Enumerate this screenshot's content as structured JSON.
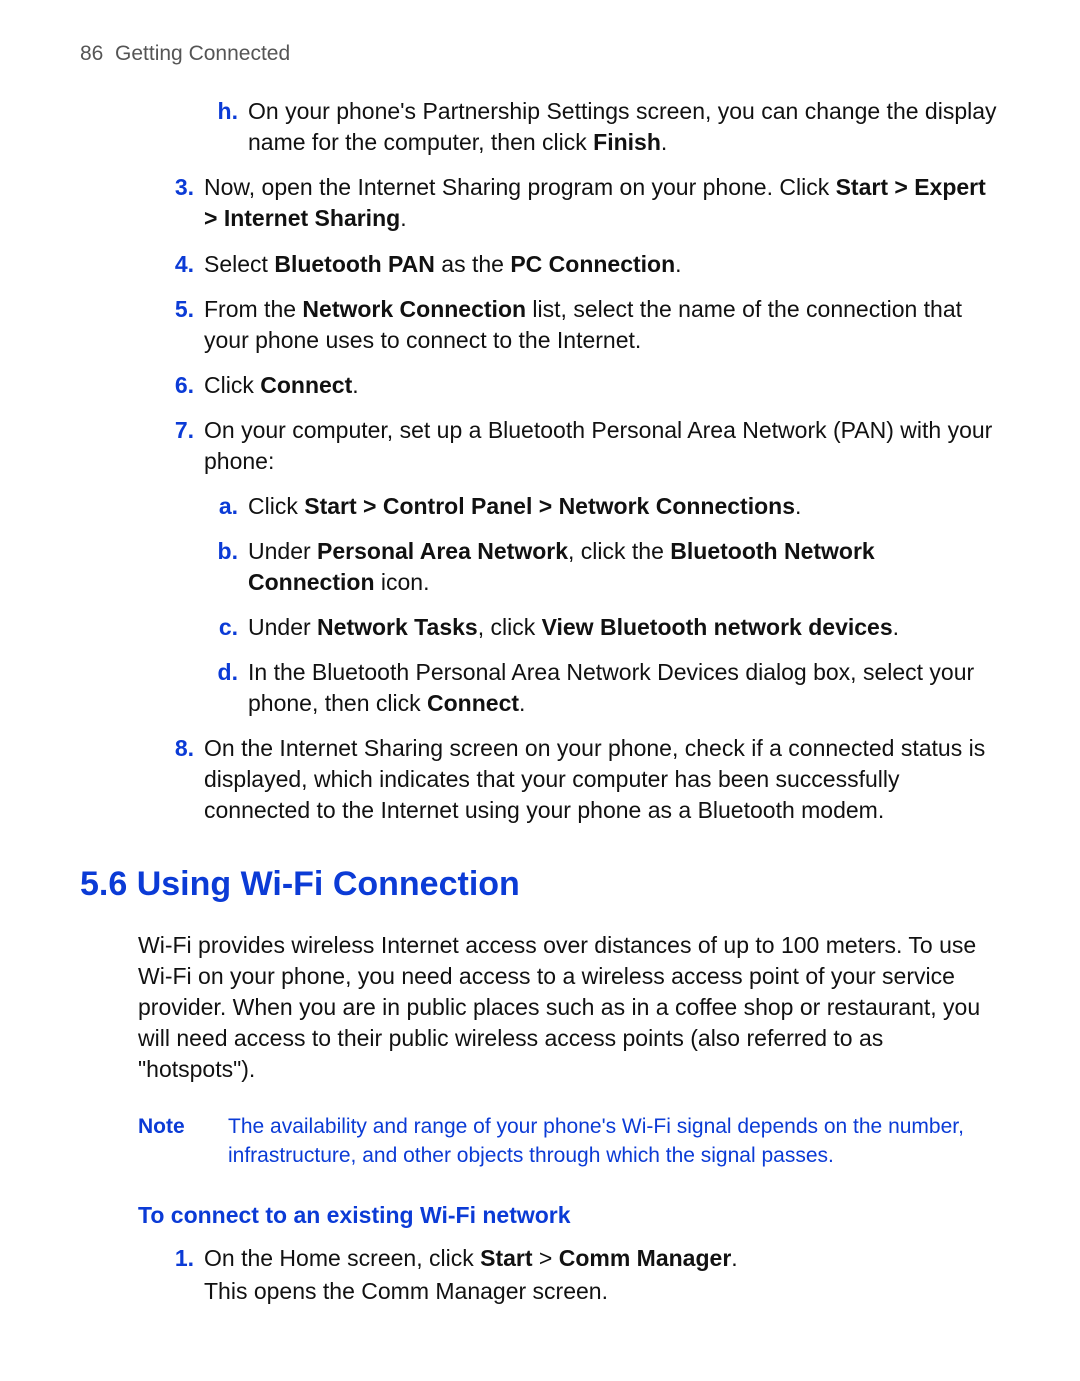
{
  "header": {
    "page_number": "86",
    "chapter_title": "Getting Connected"
  },
  "step_h": {
    "marker": "h.",
    "t1": "On your phone's Partnership Settings screen, you can change the display name for the computer, then click ",
    "b1": "Finish",
    "t2": "."
  },
  "step_3": {
    "marker": "3.",
    "t1": "Now, open the Internet Sharing program on your phone. Click ",
    "b1": "Start > Expert > Internet Sharing",
    "t2": "."
  },
  "step_4": {
    "marker": "4.",
    "t1": "Select ",
    "b1": "Bluetooth PAN",
    "t2": " as the ",
    "b2": "PC Connection",
    "t3": "."
  },
  "step_5": {
    "marker": "5.",
    "t1": "From the ",
    "b1": "Network Connection",
    "t2": " list, select the name of the connection that your phone uses to connect to the Internet."
  },
  "step_6": {
    "marker": "6.",
    "t1": "Click ",
    "b1": "Connect",
    "t2": "."
  },
  "step_7": {
    "marker": "7.",
    "t1": "On your computer, set up a Bluetooth Personal Area Network (PAN) with your phone:"
  },
  "step_7a": {
    "marker": "a.",
    "t1": "Click ",
    "b1": "Start > Control Panel > Network Connections",
    "t2": "."
  },
  "step_7b": {
    "marker": "b.",
    "t1": "Under ",
    "b1": "Personal Area Network",
    "t2": ", click the ",
    "b2": "Bluetooth Network Connection",
    "t3": " icon."
  },
  "step_7c": {
    "marker": "c.",
    "t1": "Under ",
    "b1": "Network Tasks",
    "t2": ", click ",
    "b2": "View Bluetooth network devices",
    "t3": "."
  },
  "step_7d": {
    "marker": "d.",
    "t1": "In the Bluetooth Personal Area Network Devices dialog box, select your phone, then click ",
    "b1": "Connect",
    "t2": "."
  },
  "step_8": {
    "marker": "8.",
    "t1": "On the Internet Sharing screen on your phone, check if a connected status is displayed, which indicates that your computer has been successfully connected to the Internet using your phone as a Bluetooth modem."
  },
  "section": {
    "heading": "5.6 Using Wi-Fi Connection",
    "intro": "Wi-Fi provides wireless Internet access over distances of up to 100 meters. To use Wi-Fi on your phone, you need access to a wireless access point of your service provider. When you are in public places such as in a coffee shop or restaurant, you will need access to their public wireless access points (also referred to as \"hotspots\")."
  },
  "note": {
    "label": "Note",
    "body": "The availability and range of your phone's Wi-Fi signal depends on the number, infrastructure, and other objects through which the signal passes."
  },
  "sub_heading": "To connect to an existing Wi-Fi network",
  "wifi_step_1": {
    "marker": "1.",
    "t1": "On the Home screen, click ",
    "b1": "Start",
    "t2": " > ",
    "b2": "Comm Manager",
    "t3": ".",
    "line2": "This opens the Comm Manager screen."
  }
}
